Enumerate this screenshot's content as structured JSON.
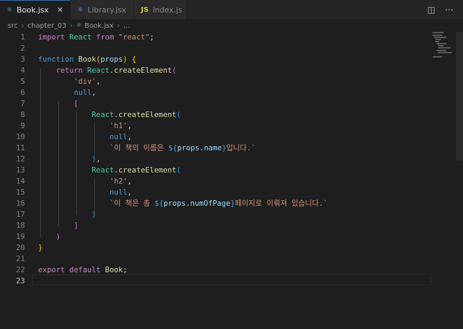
{
  "tabs": [
    {
      "label": "Book.jsx",
      "icon": "react-icon",
      "active": true
    },
    {
      "label": "Library.jsx",
      "icon": "react-icon",
      "active": false
    },
    {
      "label": "index.js",
      "icon": "js-icon",
      "active": false
    }
  ],
  "tab_close_glyph": "✕",
  "js_icon_text": "JS",
  "breadcrumb": {
    "folder1": "src",
    "folder2": "chapter_03",
    "file": "Book.jsx",
    "more": "…"
  },
  "editor": {
    "current_line": 23,
    "lines": [
      {
        "n": "1",
        "t": [
          "import",
          " ",
          "React",
          " ",
          "from",
          " ",
          "\"react\"",
          ";"
        ]
      },
      {
        "n": "2",
        "t": []
      },
      {
        "n": "3",
        "t": [
          "function",
          " ",
          "Book",
          "(",
          "props",
          ")",
          " ",
          "{"
        ]
      },
      {
        "n": "4",
        "t": [
          "    ",
          "return",
          " ",
          "React",
          ".",
          "createElement",
          "("
        ]
      },
      {
        "n": "5",
        "t": [
          "        ",
          "'div'",
          ","
        ]
      },
      {
        "n": "6",
        "t": [
          "        ",
          "null",
          ","
        ]
      },
      {
        "n": "7",
        "t": [
          "        ",
          "["
        ]
      },
      {
        "n": "8",
        "t": [
          "            ",
          "React",
          ".",
          "createElement",
          "("
        ]
      },
      {
        "n": "9",
        "t": [
          "                ",
          "'h1'",
          ","
        ]
      },
      {
        "n": "10",
        "t": [
          "                ",
          "null",
          ","
        ]
      },
      {
        "n": "11",
        "t": [
          "                ",
          "`이 책의 이름은 ",
          "${",
          "props",
          ".",
          "name",
          "}",
          "입니다.`"
        ]
      },
      {
        "n": "12",
        "t": [
          "            ",
          ")",
          ","
        ]
      },
      {
        "n": "13",
        "t": [
          "            ",
          "React",
          ".",
          "createElement",
          "("
        ]
      },
      {
        "n": "14",
        "t": [
          "                ",
          "'h2'",
          ","
        ]
      },
      {
        "n": "15",
        "t": [
          "                ",
          "null",
          ","
        ]
      },
      {
        "n": "16",
        "t": [
          "                ",
          "`이 책은 총 ",
          "${",
          "props",
          ".",
          "numOfPage",
          "}",
          "페이지로 이뤄져 있습니다.`"
        ]
      },
      {
        "n": "17",
        "t": [
          "            ",
          ")"
        ]
      },
      {
        "n": "18",
        "t": [
          "        ",
          "]"
        ]
      },
      {
        "n": "19",
        "t": [
          "    ",
          ")"
        ]
      },
      {
        "n": "20",
        "t": [
          "}"
        ]
      },
      {
        "n": "21",
        "t": []
      },
      {
        "n": "22",
        "t": [
          "export",
          " ",
          "default",
          " ",
          "Book",
          ";"
        ]
      },
      {
        "n": "23",
        "t": []
      }
    ]
  }
}
